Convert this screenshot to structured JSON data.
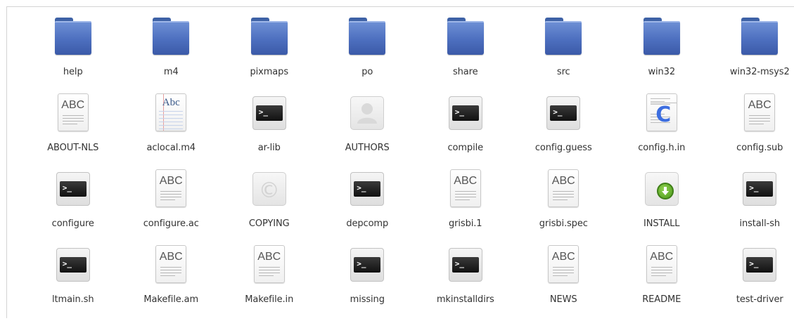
{
  "files": [
    {
      "name": "help",
      "icon": "folder-icon"
    },
    {
      "name": "m4",
      "icon": "folder-icon"
    },
    {
      "name": "pixmaps",
      "icon": "folder-icon"
    },
    {
      "name": "po",
      "icon": "folder-icon"
    },
    {
      "name": "share",
      "icon": "folder-icon"
    },
    {
      "name": "src",
      "icon": "folder-icon"
    },
    {
      "name": "win32",
      "icon": "folder-icon"
    },
    {
      "name": "win32-msys2",
      "icon": "folder-icon"
    },
    {
      "name": "ABOUT-NLS",
      "icon": "text-document-icon"
    },
    {
      "name": "aclocal.m4",
      "icon": "text-document-icon"
    },
    {
      "name": "ar-lib",
      "icon": "terminal-script-icon"
    },
    {
      "name": "AUTHORS",
      "icon": "person-document-icon"
    },
    {
      "name": "compile",
      "icon": "terminal-script-icon"
    },
    {
      "name": "config.guess",
      "icon": "terminal-script-icon"
    },
    {
      "name": "config.h.in",
      "icon": "c-source-icon"
    },
    {
      "name": "config.sub",
      "icon": "text-document-icon"
    },
    {
      "name": "configure",
      "icon": "terminal-script-icon"
    },
    {
      "name": "configure.ac",
      "icon": "text-document-icon"
    },
    {
      "name": "COPYING",
      "icon": "copyright-document-icon"
    },
    {
      "name": "depcomp",
      "icon": "terminal-script-icon"
    },
    {
      "name": "grisbi.1",
      "icon": "text-document-icon"
    },
    {
      "name": "grisbi.spec",
      "icon": "text-document-icon"
    },
    {
      "name": "INSTALL",
      "icon": "install-document-icon"
    },
    {
      "name": "install-sh",
      "icon": "terminal-script-icon"
    },
    {
      "name": "ltmain.sh",
      "icon": "terminal-script-icon"
    },
    {
      "name": "Makefile.am",
      "icon": "text-document-icon"
    },
    {
      "name": "Makefile.in",
      "icon": "text-document-icon"
    },
    {
      "name": "missing",
      "icon": "terminal-script-icon"
    },
    {
      "name": "mkinstalldirs",
      "icon": "terminal-script-icon"
    },
    {
      "name": "NEWS",
      "icon": "text-document-icon"
    },
    {
      "name": "README",
      "icon": "text-document-icon"
    },
    {
      "name": "test-driver",
      "icon": "terminal-script-icon"
    }
  ],
  "icon_text": {
    "abc": "ABC",
    "abc_serif": "Abc",
    "prompt": ">_",
    "c": "C",
    "copyright": "©"
  },
  "colors": {
    "folder": "#4d6fbf",
    "c_source": "#3d6ee0",
    "install": "#4c9a1b",
    "label": "#333333"
  }
}
